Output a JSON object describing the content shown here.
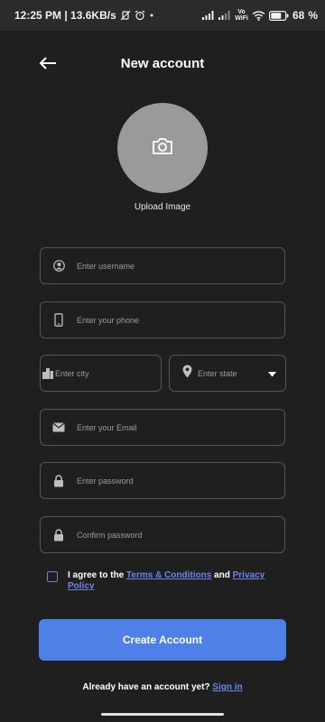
{
  "status_bar": {
    "time_speed": "12:25 PM | 13.6KB/s",
    "volte_top": "Vo",
    "volte_bottom": "WiFi",
    "battery": "68"
  },
  "header": {
    "title": "New account"
  },
  "avatar": {
    "upload_label": "Upload Image"
  },
  "form": {
    "username_placeholder": "Enter username",
    "phone_placeholder": "Enter your phone",
    "city_placeholder": "Enter city",
    "state_selected": "Enter state",
    "email_placeholder": "Enter your Email",
    "password_placeholder": "Enter password",
    "confirm_placeholder": "Confirm password"
  },
  "terms": {
    "prefix": "I agree to the ",
    "terms_link": "Terms & Conditions",
    "and": " and ",
    "privacy_link": "Privacy Policy"
  },
  "buttons": {
    "create": "Create Account"
  },
  "footer": {
    "prompt": "Already have an account yet? ",
    "signin": "Sign in"
  },
  "colors": {
    "background": "#1f1f1f",
    "accent": "#4f80e8",
    "link": "#6f86e8",
    "avatar": "#9a9a9a"
  }
}
